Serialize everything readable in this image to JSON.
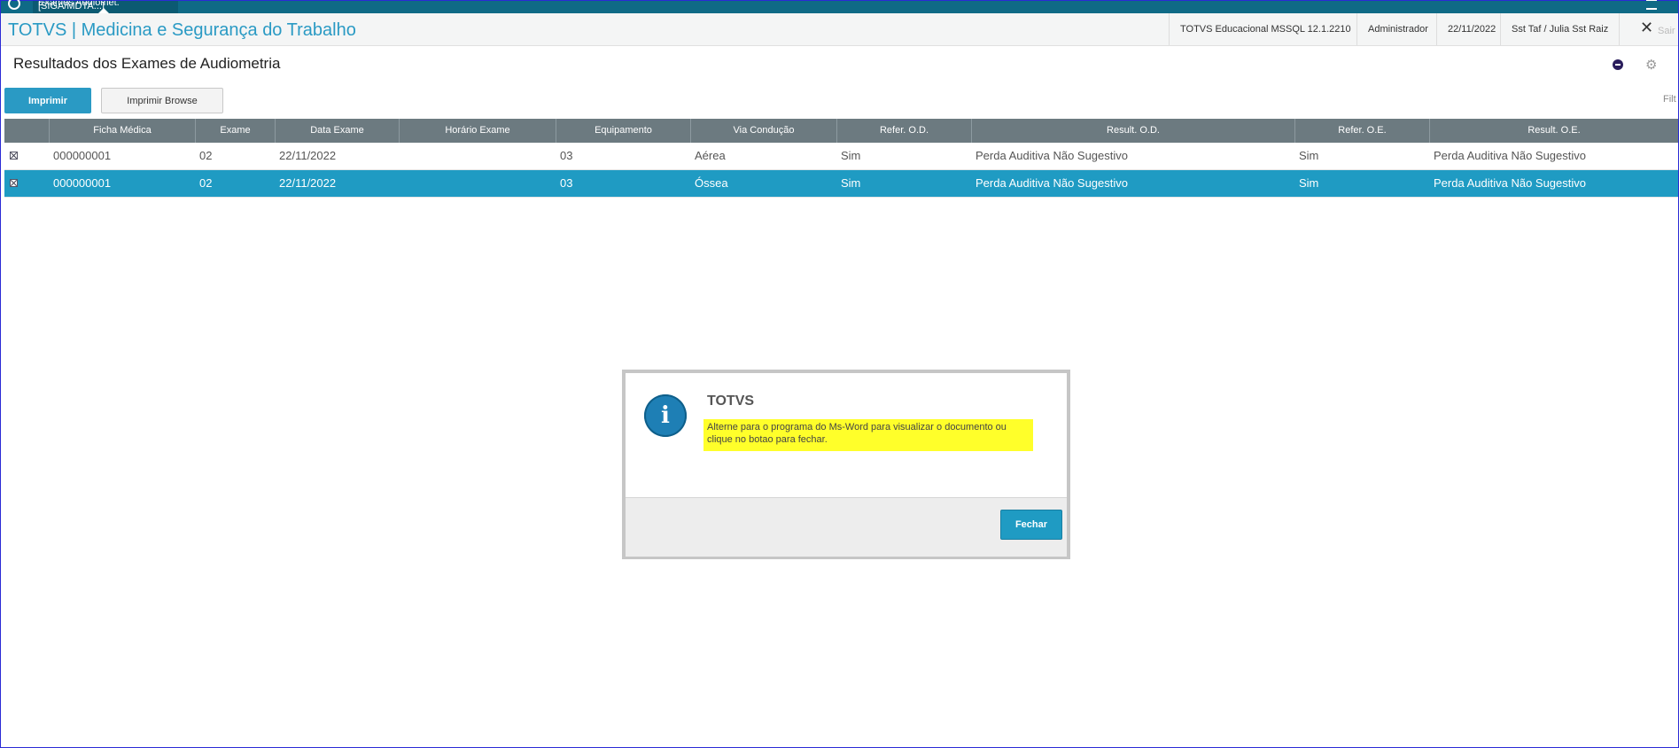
{
  "top_tab": {
    "label": "Exames Audiomet. [SIGA/MDTA...]"
  },
  "header": {
    "app_title": "TOTVS | Medicina e Segurança do Trabalho",
    "environment": "TOTVS Educacional MSSQL 12.1.2210",
    "user": "Administrador",
    "date": "22/11/2022",
    "branch": "Sst Taf / Julia Sst Raiz",
    "close_label": "Sair"
  },
  "page": {
    "title": "Resultados dos Exames de Audiometria",
    "filter_label": "Filt"
  },
  "toolbar": {
    "print_label": "Imprimir",
    "print_browse_label": "Imprimir Browse"
  },
  "grid": {
    "columns": [
      "Ficha Médica",
      "Exame",
      "Data Exame",
      "Horário Exame",
      "Equipamento",
      "Via Condução",
      "Refer. O.D.",
      "Result. O.D.",
      "Refer. O.E.",
      "Result. O.E."
    ],
    "rows": [
      {
        "ficha": "000000001",
        "exame": "02",
        "data": "22/11/2022",
        "horario": "",
        "equipamento": "03",
        "via": "Aérea",
        "ref_od": "Sim",
        "res_od": "Perda Auditiva Não Sugestivo",
        "ref_oe": "Sim",
        "res_oe": "Perda Auditiva Não Sugestivo"
      },
      {
        "ficha": "000000001",
        "exame": "02",
        "data": "22/11/2022",
        "horario": "",
        "equipamento": "03",
        "via": "Óssea",
        "ref_od": "Sim",
        "res_od": "Perda Auditiva Não Sugestivo",
        "ref_oe": "Sim",
        "res_oe": "Perda Auditiva Não Sugestivo"
      }
    ],
    "selected_row": 1
  },
  "dialog": {
    "title": "TOTVS",
    "message": "Alterne para o programa do Ms-Word para visualizar o documento ou clique no botao para fechar.",
    "close_button": "Fechar",
    "icon": "info-icon"
  },
  "colors": {
    "accent": "#2a9ac4",
    "grid_header": "#6c7a80",
    "selected_row": "#1f9bc3",
    "highlight": "#ffff2a"
  }
}
